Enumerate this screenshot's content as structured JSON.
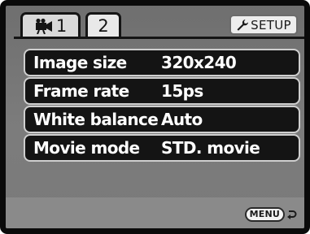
{
  "tabs": [
    {
      "label": "1",
      "icon": "movie-camera-icon"
    },
    {
      "label": "2"
    }
  ],
  "setup_button": {
    "label": "SETUP",
    "icon": "wrench-icon"
  },
  "menu_items": [
    {
      "label": "Image size",
      "value": "320x240"
    },
    {
      "label": "Frame rate",
      "value": "15ps"
    },
    {
      "label": "White balance",
      "value": "Auto"
    },
    {
      "label": "Movie mode",
      "value": "STD. movie"
    }
  ],
  "footer": {
    "menu_key": "MENU",
    "icon": "return-arrow-icon"
  },
  "colors": {
    "row_background": "#141414",
    "row_border": "#cfcfcf",
    "screen_background": "#777777",
    "text": "#ffffff"
  }
}
